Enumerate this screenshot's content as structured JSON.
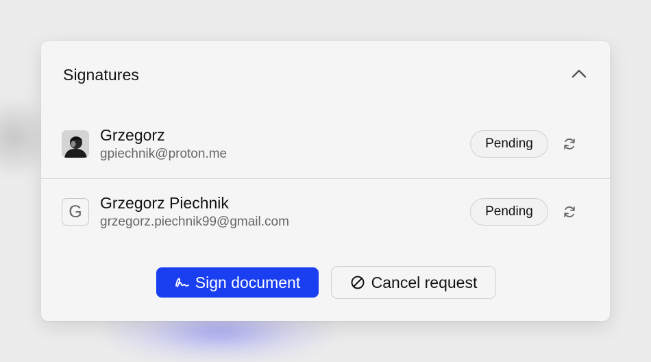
{
  "panel": {
    "title": "Signatures",
    "collapse_icon": "chevron-up-icon"
  },
  "signers": [
    {
      "name": "Grzegorz",
      "email": "gpiechnik@proton.me",
      "avatar": "photo",
      "status": "Pending",
      "action_icon": "refresh-icon"
    },
    {
      "name": "Grzegorz Piechnik",
      "email": "grzegorz.piechnik99@gmail.com",
      "avatar_letter": "G",
      "status": "Pending",
      "action_icon": "refresh-icon"
    }
  ],
  "actions": {
    "sign_label": "Sign document",
    "sign_icon": "signature-icon",
    "cancel_label": "Cancel request",
    "cancel_icon": "cancel-circle-icon"
  },
  "colors": {
    "primary": "#1a3ff0",
    "card_bg": "#f5f5f5",
    "muted_text": "#666666"
  }
}
